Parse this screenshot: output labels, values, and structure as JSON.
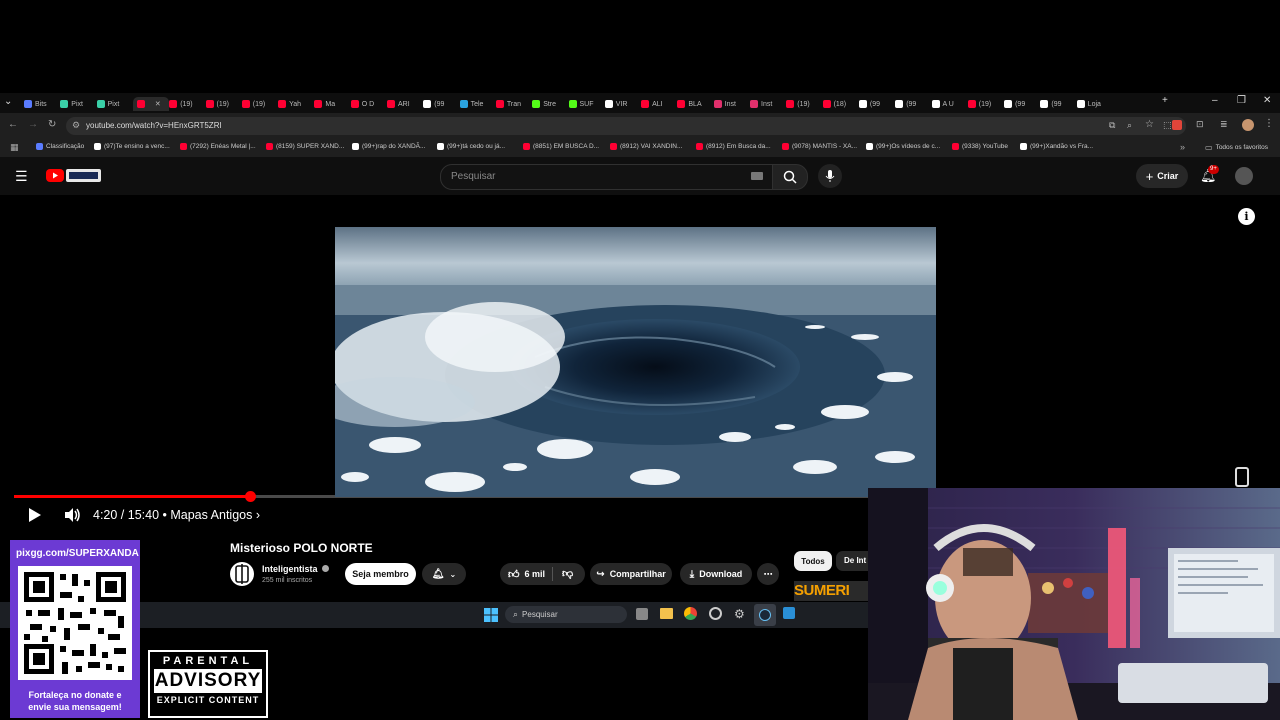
{
  "browser": {
    "tabs": [
      {
        "label": "Bits",
        "color": "#5a7cff"
      },
      {
        "label": "Pixt",
        "color": "#3ad0a8"
      },
      {
        "label": "Pixt",
        "color": "#3ad0a8"
      },
      {
        "label": "",
        "color": "#ff0033",
        "active": true
      },
      {
        "label": "(19)",
        "color": "#ff0033"
      },
      {
        "label": "(19)",
        "color": "#ff0033"
      },
      {
        "label": "(19)",
        "color": "#ff0033"
      },
      {
        "label": "Yah",
        "color": "#ff0033"
      },
      {
        "label": "Ma",
        "color": "#ff0033"
      },
      {
        "label": "O D",
        "color": "#ff0033"
      },
      {
        "label": "ARI",
        "color": "#ff0033"
      },
      {
        "label": "(99",
        "color": "#ffffff"
      },
      {
        "label": "Tele",
        "color": "#2aa3e0"
      },
      {
        "label": "Tran",
        "color": "#ff0033"
      },
      {
        "label": "Stre",
        "color": "#53fc18"
      },
      {
        "label": "SUF",
        "color": "#53fc18"
      },
      {
        "label": "VIR",
        "color": "#ffffff"
      },
      {
        "label": "ALI",
        "color": "#ff0033"
      },
      {
        "label": "BLA",
        "color": "#ff0033"
      },
      {
        "label": "Inst",
        "color": "#e1306c"
      },
      {
        "label": "Inst",
        "color": "#e1306c"
      },
      {
        "label": "(19)",
        "color": "#ff0033"
      },
      {
        "label": "(18)",
        "color": "#ff0033"
      },
      {
        "label": "(99",
        "color": "#ffffff"
      },
      {
        "label": "(99",
        "color": "#ffffff"
      },
      {
        "label": "A U",
        "color": "#ffffff"
      },
      {
        "label": "(19)",
        "color": "#ff0033"
      },
      {
        "label": "(99",
        "color": "#ffffff"
      },
      {
        "label": "(99",
        "color": "#ffffff"
      },
      {
        "label": "Loja",
        "color": "#ffffff"
      }
    ],
    "url": "youtube.com/watch?v=HEnxGRT5ZRI",
    "bookmarks": [
      {
        "label": "Classificação",
        "color": "#5a7cff"
      },
      {
        "label": "(97)Te ensino a venc...",
        "color": "#ffffff"
      },
      {
        "label": "(7292) Enéas Metal |...",
        "color": "#ff0033"
      },
      {
        "label": "(8159) SUPER XAND...",
        "color": "#ff0033"
      },
      {
        "label": "(99+)rap do XANDÃ...",
        "color": "#ffffff"
      },
      {
        "label": "(99+)tá cedo ou já...",
        "color": "#ffffff"
      },
      {
        "label": "(8851) EM BUSCA D...",
        "color": "#ff0033"
      },
      {
        "label": "(8912) VAI XANDIN...",
        "color": "#ff0033"
      },
      {
        "label": "(8912) Em Busca da...",
        "color": "#ff0033"
      },
      {
        "label": "(9078) MANTIS - XA...",
        "color": "#ff0033"
      },
      {
        "label": "(99+)Os vídeos de c...",
        "color": "#ffffff"
      },
      {
        "label": "(9338) YouTube",
        "color": "#ff0033"
      },
      {
        "label": "(99+)Xandão vs Fra...",
        "color": "#ffffff"
      }
    ],
    "all_favorites": "Todos os favoritos"
  },
  "youtube": {
    "search_placeholder": "Pesquisar",
    "create_label": "Criar",
    "notif_badge": "9+"
  },
  "video": {
    "progress": 0.2766,
    "time_display": "4:20 / 15:40 • Mapas Antigos ›",
    "title": "Misterioso POLO NORTE",
    "channel_name": "Inteligentista",
    "subscribers": "255 mil inscritos",
    "join_label": "Seja membro",
    "likes": "6 mil",
    "share_label": "Compartilhar",
    "download_label": "Download",
    "chip_all": "Todos",
    "chip_channel": "De Int",
    "thumb_text": "SUMERI"
  },
  "taskbar": {
    "search_placeholder": "Pesquisar"
  },
  "overlay": {
    "donate_url": "pixgg.com/SUPERXANDA",
    "donate_message_1": "Fortaleça no donate e",
    "donate_message_2": "envie sua mensagem!",
    "advisory_1": "PARENTAL",
    "advisory_2": "ADVISORY",
    "advisory_3": "EXPLICIT CONTENT"
  },
  "colors": {
    "accent_red": "#ff0000",
    "donate_purple": "#6c3ad3",
    "yt_bg": "#0f0f0f"
  }
}
